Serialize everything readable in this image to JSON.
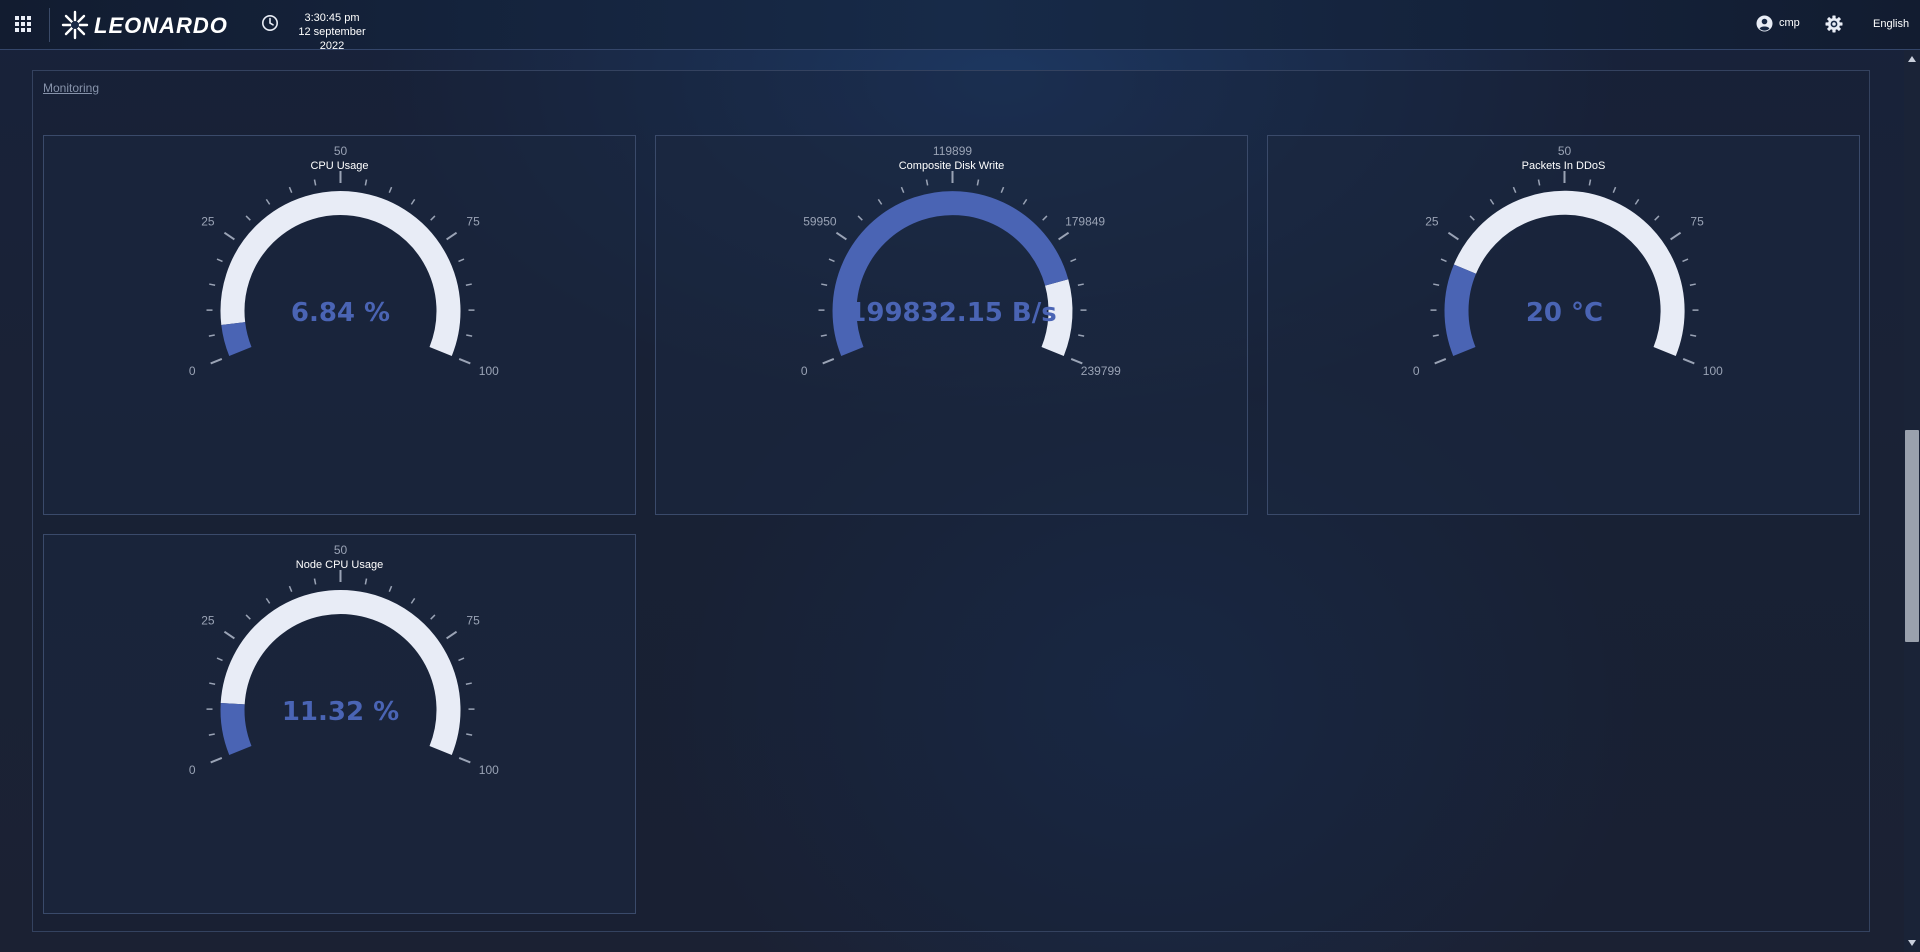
{
  "header": {
    "logo_text": "LEONARDO",
    "time": "3:30:45 pm",
    "date": "12 september 2022",
    "user": "cmp",
    "language": "English",
    "icons": [
      "apps-grid-icon",
      "clock-icon",
      "user-icon",
      "settings-icon"
    ]
  },
  "breadcrumb": "Monitoring",
  "colors": {
    "gauge_value": "#4a64b4",
    "gauge_track": "#e8ecf6",
    "tick": "#9aa3b5",
    "label": "#9aa3b5"
  },
  "gauges": [
    {
      "title": "CPU Usage",
      "min": 0,
      "max": 100,
      "value": 6.84,
      "value_text": "6.84 %",
      "labels": [
        "0",
        "25",
        "50",
        "75",
        "100"
      ]
    },
    {
      "title": "Composite Disk Write",
      "min": 0,
      "max": 239799,
      "value": 199832.15,
      "value_text": "199832.15 B/s",
      "labels": [
        "0",
        "59950",
        "119899",
        "179849",
        "239799"
      ]
    },
    {
      "title": "Packets In DDoS",
      "min": 0,
      "max": 100,
      "value": 20,
      "value_text": "20 °C",
      "labels": [
        "0",
        "25",
        "50",
        "75",
        "100"
      ]
    },
    {
      "title": "Node CPU Usage",
      "min": 0,
      "max": 100,
      "value": 11.32,
      "value_text": "11.32 %",
      "labels": [
        "0",
        "25",
        "50",
        "75",
        "100"
      ]
    }
  ]
}
